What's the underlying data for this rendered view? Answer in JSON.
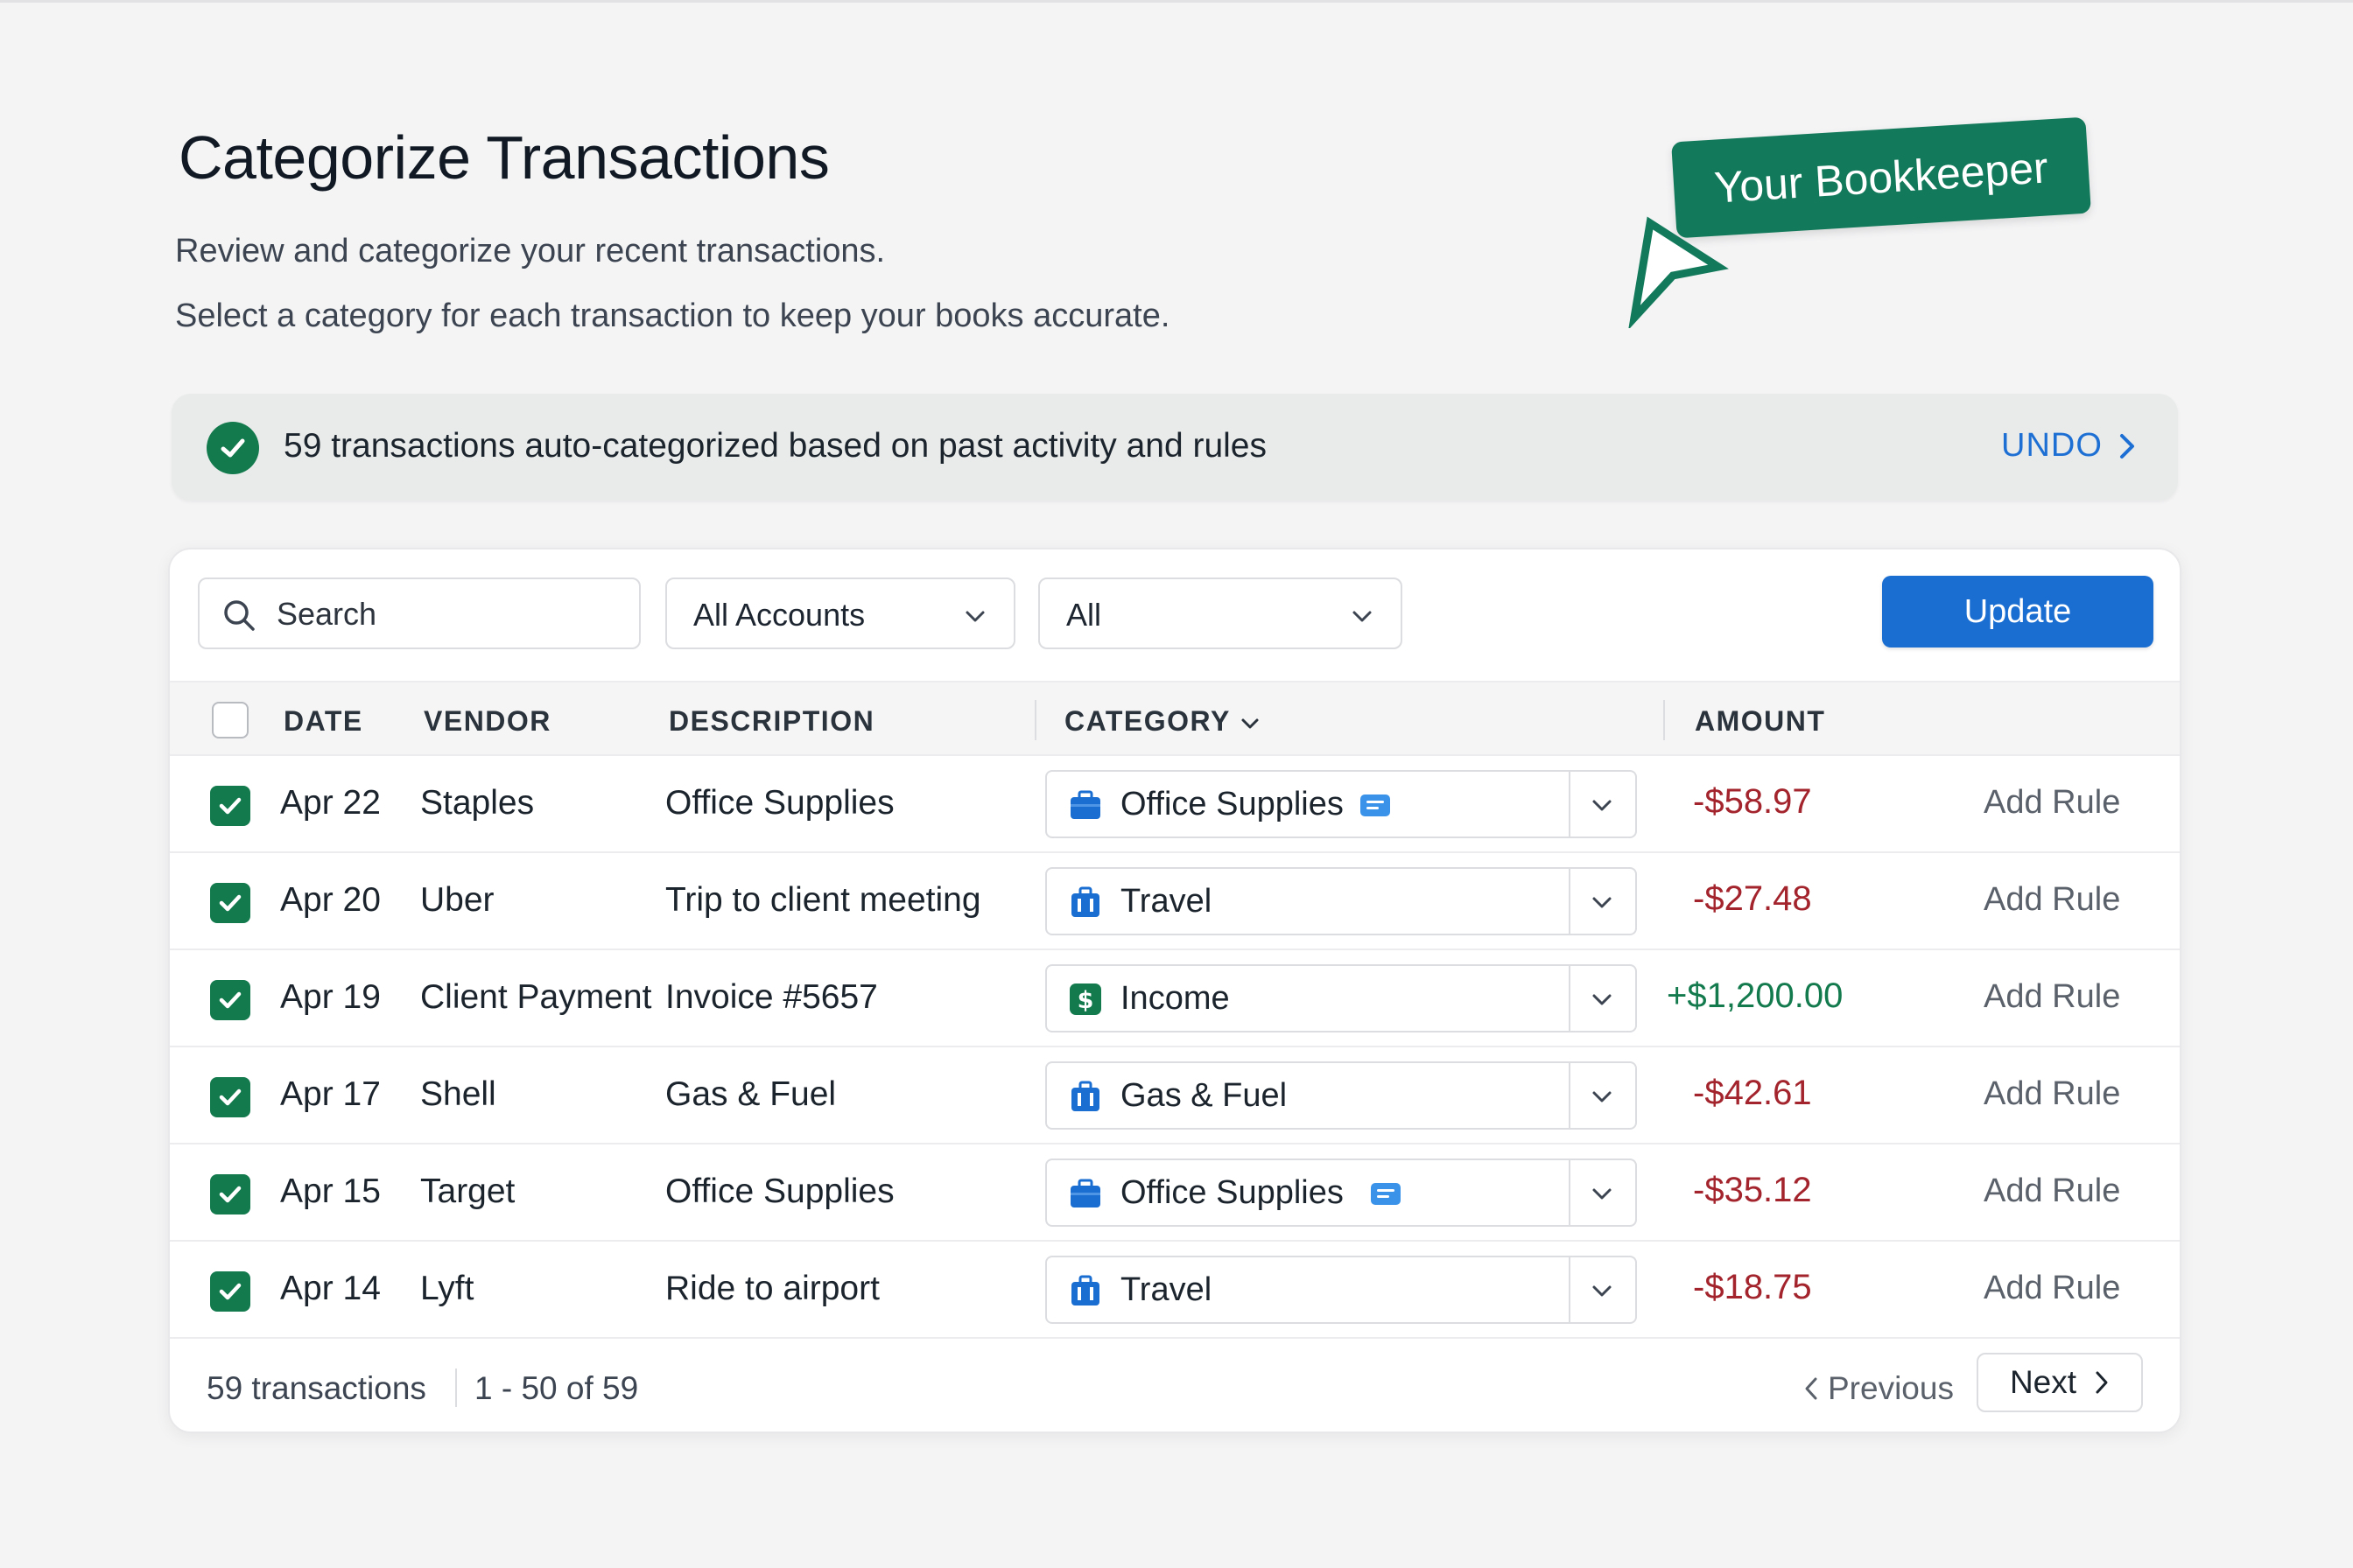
{
  "header": {
    "title": "Categorize Transactions",
    "subtitle_1": "Review and categorize your recent transactions.",
    "subtitle_2": "Select a category for each transaction to keep your books accurate."
  },
  "callout": {
    "label": "Your Bookkeeper",
    "color": "#127a5a"
  },
  "banner": {
    "text": "59 transactions auto-categorized based on past activity and rules",
    "undo_label": "UNDO"
  },
  "toolbar": {
    "search_placeholder": "Search",
    "accounts_filter": "All Accounts",
    "type_filter": "All",
    "update_label": "Update"
  },
  "table": {
    "columns": {
      "date": "DATE",
      "vendor": "VENDOR",
      "description": "DESCRIPTION",
      "category": "CATEGORY",
      "amount": "AMOUNT"
    },
    "rows": [
      {
        "checked": true,
        "date": "Apr 22",
        "vendor": "Staples",
        "description": "Office Supplies",
        "category": "Office Supplies",
        "category_icon": "briefcase-icon",
        "has_note": true,
        "amount": "-$58.97",
        "action": "Add Rule"
      },
      {
        "checked": true,
        "date": "Apr 20",
        "vendor": "Uber",
        "description": "Trip to client meeting",
        "category": "Travel",
        "category_icon": "suitcase-icon",
        "has_note": false,
        "amount": "-$27.48",
        "action": "Add Rule"
      },
      {
        "checked": true,
        "date": "Apr 19",
        "vendor": "Client Payment",
        "description": "Invoice #5657",
        "category": "Income",
        "category_icon": "dollar-icon",
        "has_note": false,
        "amount": "+$1,200.00",
        "action": "Add Rule"
      },
      {
        "checked": true,
        "date": "Apr 17",
        "vendor": "Shell",
        "description": "Gas & Fuel",
        "category": "Gas & Fuel",
        "category_icon": "suitcase-icon",
        "has_note": false,
        "amount": "-$42.61",
        "action": "Add Rule"
      },
      {
        "checked": true,
        "date": "Apr 15",
        "vendor": "Target",
        "description": "Office Supplies",
        "category": "Office Supplies",
        "category_icon": "briefcase-icon",
        "has_note": true,
        "amount": "-$35.12",
        "action": "Add Rule"
      },
      {
        "checked": true,
        "date": "Apr 14",
        "vendor": "Lyft",
        "description": "Ride to airport",
        "category": "Travel",
        "category_icon": "suitcase-icon",
        "has_note": false,
        "amount": "-$18.75",
        "action": "Add Rule"
      }
    ]
  },
  "footer": {
    "count": "59 transactions",
    "range": "1 - 50 of 59",
    "previous_label": "Previous",
    "next_label": "Next"
  },
  "colors": {
    "accent_blue": "#1a6ed1",
    "success_green": "#137a4e",
    "negative_red": "#a3242c"
  }
}
